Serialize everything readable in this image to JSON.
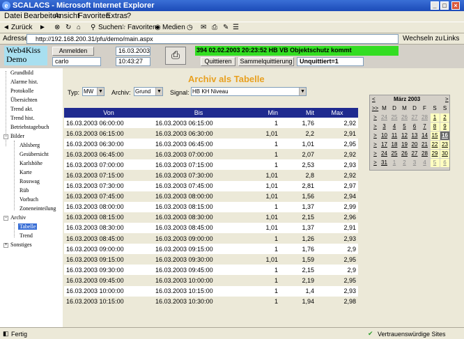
{
  "browser": {
    "title": "SCALACS - Microsoft Internet Explorer",
    "menu": [
      "Datei",
      "Bearbeiten",
      "Ansicht",
      "Favoriten",
      "Extras",
      "?"
    ],
    "toolbar": {
      "back": "Zurück",
      "search": "Suchen",
      "favorites": "Favoriten",
      "media": "Medien"
    },
    "address_label": "Adresse",
    "address": "http://192.168.200.31/pfu/demo/main.aspx",
    "go": "Wechseln zu",
    "links": "Links",
    "status_left": "Fertig",
    "status_right": "Vertrauenswürdige Sites"
  },
  "header": {
    "logo_line1": "Web4Kiss",
    "logo_line2": "Demo",
    "anmelden": "Anmelden",
    "user": "carlo",
    "date": "16.03.2003",
    "time": "10:43:27",
    "alarm_text": "394 02.02.2003 20:23:52 HB VB Objektschutz kommt",
    "quittieren": "Quittieren",
    "sammel": "Sammelquittierung",
    "unquittiert": "Unquittiert=1"
  },
  "nav": {
    "top_items": [
      "Grundbild",
      "Alarme hist.",
      "Protokolle",
      "Übersichten",
      "Trend akt.",
      "Trend hist.",
      "Betriebstagebuch"
    ],
    "bilder": "Bilder",
    "bilder_items": [
      "Ahlsberg",
      "Gesübersicht",
      "Karlshöhe",
      "Karte",
      "Rosswag",
      "Rüb",
      "Vorbuch",
      "Zoneneinteilung"
    ],
    "archiv": "Archiv",
    "archiv_items": [
      "Tabelle",
      "Trend"
    ],
    "sonstiges": "Sonstiges"
  },
  "content": {
    "title": "Archiv als Tabelle",
    "typ_label": "Typ:",
    "typ_value": "MW",
    "archiv_label": "Archiv:",
    "archiv_value": "Grund",
    "signal_label": "Signal:",
    "signal_value": "HB KH Niveau"
  },
  "table": {
    "headers": [
      "Von",
      "Bis",
      "Min",
      "Mit",
      "Max"
    ],
    "rows": [
      [
        "16.03.2003 06:00:00",
        "16.03.2003 06:15:00",
        "1",
        "1,76",
        "2,92"
      ],
      [
        "16.03.2003 06:15:00",
        "16.03.2003 06:30:00",
        "1,01",
        "2,2",
        "2,91"
      ],
      [
        "16.03.2003 06:30:00",
        "16.03.2003 06:45:00",
        "1",
        "1,01",
        "2,95"
      ],
      [
        "16.03.2003 06:45:00",
        "16.03.2003 07:00:00",
        "1",
        "2,07",
        "2,92"
      ],
      [
        "16.03.2003 07:00:00",
        "16.03.2003 07:15:00",
        "1",
        "2,53",
        "2,93"
      ],
      [
        "16.03.2003 07:15:00",
        "16.03.2003 07:30:00",
        "1,01",
        "2,8",
        "2,92"
      ],
      [
        "16.03.2003 07:30:00",
        "16.03.2003 07:45:00",
        "1,01",
        "2,81",
        "2,97"
      ],
      [
        "16.03.2003 07:45:00",
        "16.03.2003 08:00:00",
        "1,01",
        "1,56",
        "2,94"
      ],
      [
        "16.03.2003 08:00:00",
        "16.03.2003 08:15:00",
        "1",
        "1,37",
        "2,99"
      ],
      [
        "16.03.2003 08:15:00",
        "16.03.2003 08:30:00",
        "1,01",
        "2,15",
        "2,96"
      ],
      [
        "16.03.2003 08:30:00",
        "16.03.2003 08:45:00",
        "1,01",
        "1,37",
        "2,91"
      ],
      [
        "16.03.2003 08:45:00",
        "16.03.2003 09:00:00",
        "1",
        "1,26",
        "2,93"
      ],
      [
        "16.03.2003 09:00:00",
        "16.03.2003 09:15:00",
        "1",
        "1,76",
        "2,9"
      ],
      [
        "16.03.2003 09:15:00",
        "16.03.2003 09:30:00",
        "1,01",
        "1,59",
        "2,95"
      ],
      [
        "16.03.2003 09:30:00",
        "16.03.2003 09:45:00",
        "1",
        "2,15",
        "2,9"
      ],
      [
        "16.03.2003 09:45:00",
        "16.03.2003 10:00:00",
        "1",
        "2,19",
        "2,95"
      ],
      [
        "16.03.2003 10:00:00",
        "16.03.2003 10:15:00",
        "1",
        "1,4",
        "2,93"
      ],
      [
        "16.03.2003 10:15:00",
        "16.03.2003 10:30:00",
        "1",
        "1,94",
        "2,98"
      ]
    ]
  },
  "calendar": {
    "prev": "<",
    "next": ">",
    "month": "März 2003",
    "week_nav": ">>",
    "row_nav": ">",
    "days_header": [
      "M",
      "D",
      "M",
      "D",
      "F",
      "S",
      "S"
    ],
    "weeks": [
      [
        "24",
        "25",
        "26",
        "27",
        "28",
        "1",
        "2"
      ],
      [
        "3",
        "4",
        "5",
        "6",
        "7",
        "8",
        "9"
      ],
      [
        "10",
        "11",
        "12",
        "13",
        "14",
        "15",
        "16"
      ],
      [
        "17",
        "18",
        "19",
        "20",
        "21",
        "22",
        "23"
      ],
      [
        "24",
        "25",
        "26",
        "27",
        "28",
        "29",
        "30"
      ],
      [
        "31",
        "1",
        "2",
        "3",
        "4",
        "5",
        "6"
      ]
    ],
    "selected": "16"
  }
}
